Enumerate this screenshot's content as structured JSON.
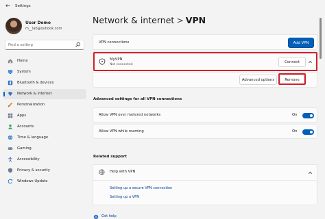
{
  "window": {
    "title": "Settings",
    "back_glyph": "←"
  },
  "user": {
    "name": "User Demo",
    "email": "m__lab@outlook.com"
  },
  "search": {
    "placeholder": "Find a setting"
  },
  "sidebar": {
    "items": [
      {
        "label": "Home",
        "icon": "home-icon"
      },
      {
        "label": "System",
        "icon": "system-icon"
      },
      {
        "label": "Bluetooth & devices",
        "icon": "bluetooth-icon"
      },
      {
        "label": "Network & internet",
        "icon": "network-icon",
        "active": true
      },
      {
        "label": "Personalization",
        "icon": "brush-icon"
      },
      {
        "label": "Apps",
        "icon": "apps-icon"
      },
      {
        "label": "Accounts",
        "icon": "accounts-icon"
      },
      {
        "label": "Time & language",
        "icon": "globe-icon"
      },
      {
        "label": "Gaming",
        "icon": "gaming-icon"
      },
      {
        "label": "Accessibility",
        "icon": "accessibility-icon"
      },
      {
        "label": "Privacy & security",
        "icon": "shield-icon"
      },
      {
        "label": "Windows Update",
        "icon": "update-icon"
      }
    ]
  },
  "header": {
    "parent": "Network & internet",
    "separator": ">",
    "current": "VPN"
  },
  "vpn": {
    "connections_label": "VPN connections",
    "add_button": "Add VPN",
    "connection": {
      "name": "MyVPN",
      "status": "Not connected",
      "connect_button": "Connect"
    },
    "advanced_options_button": "Advanced options",
    "remove_button": "Remove"
  },
  "advanced": {
    "title": "Advanced settings for all VPN connections",
    "metered": {
      "label": "Allow VPN over metered networks",
      "state": "On",
      "on": true
    },
    "roaming": {
      "label": "Allow VPN while roaming",
      "state": "On",
      "on": true
    }
  },
  "related": {
    "title": "Related support",
    "help": "Help with VPN",
    "links": [
      "Setting up a secure VPN connection",
      "Setting up a VPN"
    ]
  },
  "footer": {
    "get_help": "Get help"
  },
  "colors": {
    "accent": "#005fb8",
    "highlight": "#d0202a"
  }
}
